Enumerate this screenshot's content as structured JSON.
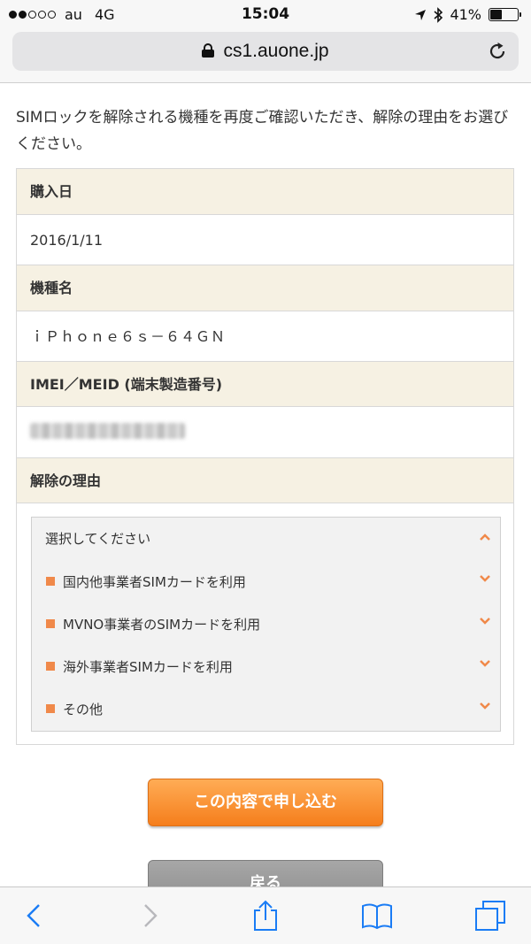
{
  "status_bar": {
    "carrier": "au",
    "network": "4G",
    "time": "15:04",
    "battery": "41%",
    "battery_level": 0.41,
    "signal_bars": 2
  },
  "browser": {
    "url": "cs1.auone.jp"
  },
  "intro_text": "SIMロックを解除される機種を再度ご確認いただき、解除の理由をお選びください。",
  "form": {
    "purchase_date_label": "購入日",
    "purchase_date": "2016/1/11",
    "model_label": "機種名",
    "model": "ｉＰｈｏｎｅ６ｓ－６４ＧＮ",
    "imei_label": "IMEI／MEID (端末製造番号)",
    "reason_label": "解除の理由",
    "reason_select": {
      "placeholder": "選択してください",
      "options": [
        "国内他事業者SIMカードを利用",
        "MVNO事業者のSIMカードを利用",
        "海外事業者SIMカードを利用",
        "その他"
      ]
    }
  },
  "buttons": {
    "apply": "この内容で申し込む",
    "back": "戻る"
  },
  "colors": {
    "accent_orange": "#f0894a",
    "header_beige": "#f6f1e3",
    "ios_blue": "#1a7cf5"
  }
}
